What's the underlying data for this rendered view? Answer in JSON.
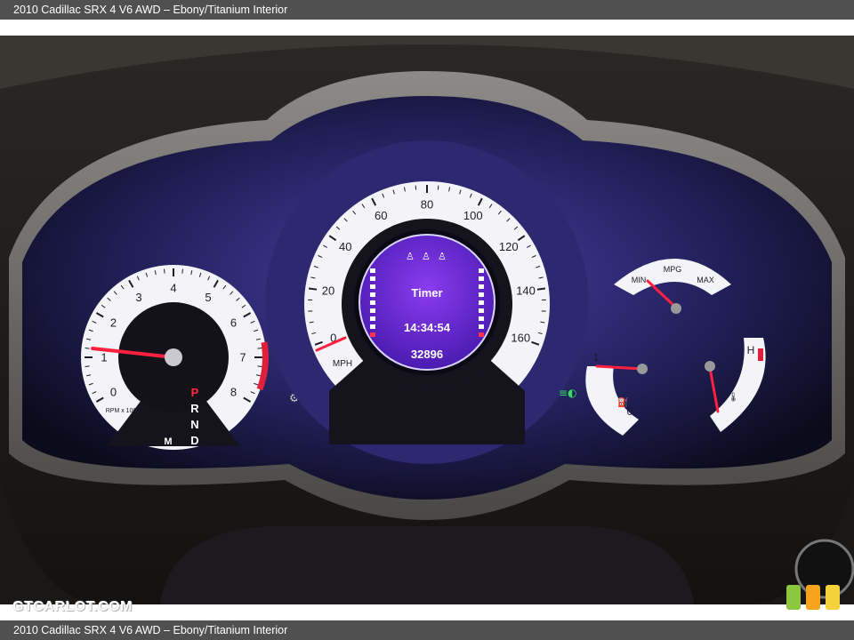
{
  "caption": "2010 Cadillac SRX 4 V6 AWD – Ebony/Titanium Interior",
  "watermark": "GTCARLOT.COM",
  "tachometer": {
    "numbers": [
      "0",
      "1",
      "2",
      "3",
      "4",
      "5",
      "6",
      "7",
      "8"
    ],
    "unit": "RPM x 1000",
    "gears": [
      "P",
      "R",
      "N",
      "D"
    ],
    "manual": "M",
    "needle_value": 1
  },
  "speedometer": {
    "numbers": [
      "0",
      "20",
      "40",
      "60",
      "80",
      "100",
      "120",
      "140",
      "160"
    ],
    "unit": "MPH",
    "needle_value": 0
  },
  "display": {
    "title": "Timer",
    "time": "14:34:54",
    "odometer": "32896"
  },
  "mpg_gauge": {
    "label": "MPG",
    "min": "MIN",
    "max": "MAX"
  },
  "fuel_gauge": {
    "full": "1",
    "empty": "0"
  },
  "temp_gauge": {
    "hot": "H"
  },
  "badge_colors": [
    "#8cc63f",
    "#f7a31c",
    "#f5d23a"
  ]
}
